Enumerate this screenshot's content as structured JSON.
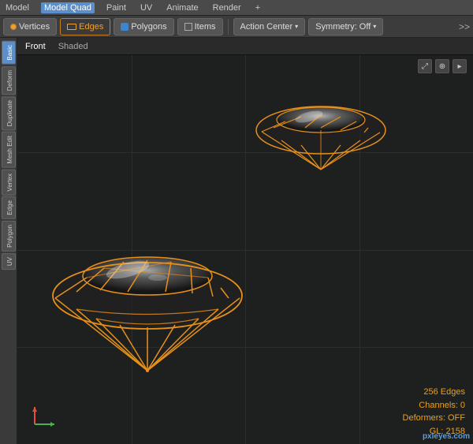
{
  "menubar": {
    "items": [
      {
        "label": "Model",
        "active": false
      },
      {
        "label": "Model Quad",
        "active": true
      },
      {
        "label": "Paint",
        "active": false
      },
      {
        "label": "UV",
        "active": false
      },
      {
        "label": "Animate",
        "active": false
      },
      {
        "label": "Render",
        "active": false
      },
      {
        "label": "+",
        "active": false
      }
    ]
  },
  "toolbar": {
    "vertices_label": "Vertices",
    "edges_label": "Edges",
    "polygons_label": "Polygons",
    "items_label": "Items",
    "action_center_label": "Action Center",
    "symmetry_label": "Symmetry: Off",
    "double_arrow": ">>"
  },
  "sidebar": {
    "tabs": [
      {
        "label": "Basic",
        "active": true
      },
      {
        "label": "Deform",
        "active": false
      },
      {
        "label": "Duplicate",
        "active": false
      },
      {
        "label": "Mesh Edit",
        "active": false
      },
      {
        "label": "Vertex",
        "active": false
      },
      {
        "label": "Edge",
        "active": false
      },
      {
        "label": "Polygon",
        "active": false
      },
      {
        "label": "UV",
        "active": false
      }
    ]
  },
  "viewport": {
    "label_front": "Front",
    "label_shaded": "Shaded"
  },
  "status": {
    "edges": "256 Edges",
    "channels": "Channels: 0",
    "deformers": "Deformers: OFF",
    "gl": "GL: 2158"
  },
  "watermark": "pxleyes.com"
}
